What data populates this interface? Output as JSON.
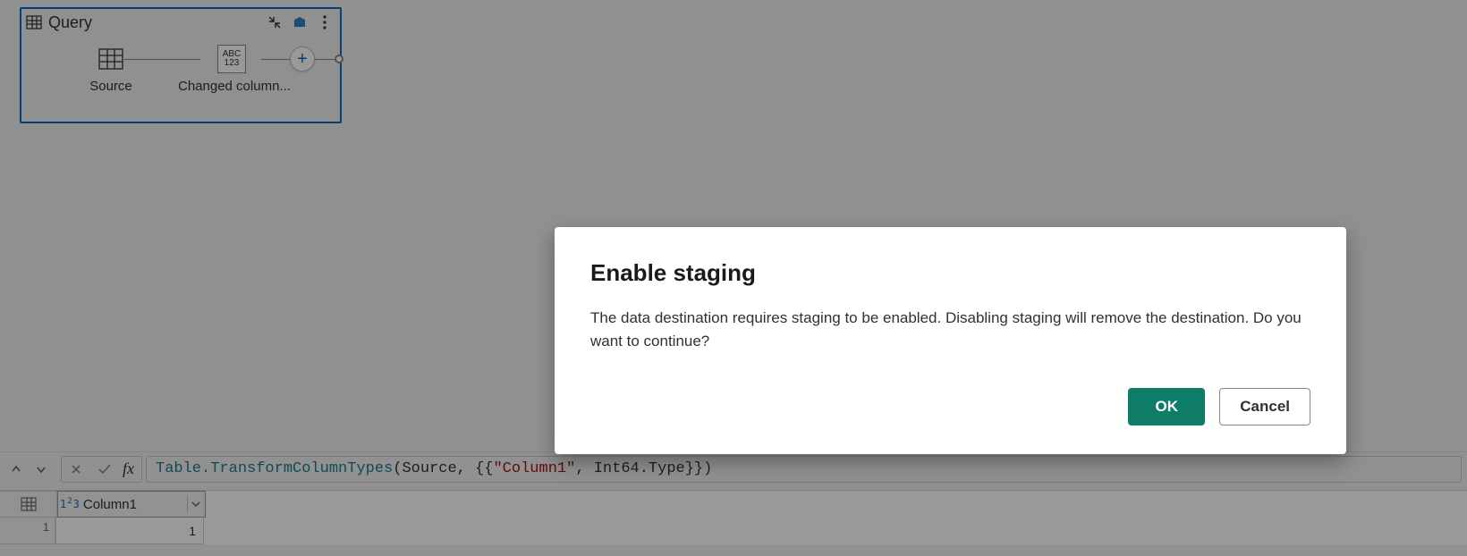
{
  "diagram": {
    "query_name": "Query",
    "steps": {
      "source": {
        "label": "Source"
      },
      "changed": {
        "label": "Changed column...",
        "chip_top": "ABC",
        "chip_bottom": "123"
      }
    }
  },
  "formula_bar": {
    "fx_label": "fx",
    "fn": "Table.TransformColumnTypes",
    "arg_ident": "Source",
    "arg_string": "\"Column1\"",
    "tail": ", Int64.Type}})"
  },
  "grid": {
    "type_chip": "1²3",
    "col1_header": "Column1",
    "row1_index": "1",
    "row1_col1": "1"
  },
  "dialog": {
    "title": "Enable staging",
    "body": "The data destination requires staging to be enabled. Disabling staging will remove the destination. Do you want to continue?",
    "ok": "OK",
    "cancel": "Cancel"
  }
}
